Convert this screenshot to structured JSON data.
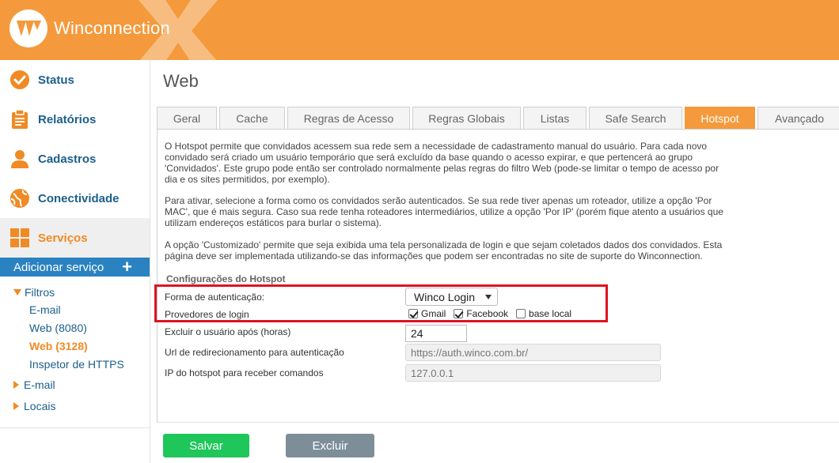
{
  "header": {
    "brand": "Winconnection"
  },
  "sidebar": {
    "items": [
      {
        "label": "Status",
        "icon": "check-circle-icon"
      },
      {
        "label": "Relatórios",
        "icon": "clipboard-icon"
      },
      {
        "label": "Cadastros",
        "icon": "user-icon"
      },
      {
        "label": "Conectividade",
        "icon": "globe-icon"
      },
      {
        "label": "Serviços",
        "icon": "grid-icon"
      }
    ],
    "add_service": "Adicionar serviço",
    "tree": {
      "filtros": "Filtros",
      "filtros_children": [
        "E-mail",
        "Web (8080)",
        "Web (3128)",
        "Inspetor de HTTPS"
      ],
      "email": "E-mail",
      "locais": "Locais"
    }
  },
  "page": {
    "title": "Web"
  },
  "tabs": [
    "Geral",
    "Cache",
    "Regras de Acesso",
    "Regras Globais",
    "Listas",
    "Safe Search",
    "Hotspot",
    "Avançado"
  ],
  "content": {
    "p1": "O Hotspot permite que convidados acessem sua rede sem a necessidade de cadastramento manual do usuário. Para cada novo convidado será criado um usuário temporário que será excluído da base quando o acesso expirar, e que pertencerá ao grupo 'Convidados'. Este grupo pode então ser controlado normalmente pelas regras do filtro Web (pode-se limitar o tempo de acesso por dia e os sites permitidos, por exemplo).",
    "p2": "Para ativar, selecione a forma como os convidados serão autenticados. Se sua rede tiver apenas um roteador, utilize a opção 'Por MAC', que é mais segura. Caso sua rede tenha roteadores intermediários, utilize a opção 'Por IP' (porém fique atento a usuários que utilizam endereços estáticos para burlar o sistema).",
    "p3": "A opção 'Customizado' permite que seja exibida uma tela personalizada de login e que sejam coletados dados dos convidados. Esta página deve ser implementada utilizando-se das informações que podem ser encontradas no site de suporte do Winconnection.",
    "section_title": "Configurações do Hotspot",
    "auth_label": "Forma de autenticação:",
    "auth_value": "Winco Login",
    "providers_label": "Provedores de login",
    "providers": [
      {
        "label": "Gmail",
        "checked": true
      },
      {
        "label": "Facebook",
        "checked": true
      },
      {
        "label": "base local",
        "checked": false
      }
    ],
    "expire_label": "Excluir o usuário após (horas)",
    "expire_value": "24",
    "redirect_label": "Url de redirecionamento para autenticação",
    "redirect_placeholder": "https://auth.winco.com.br/",
    "ip_label": "IP do hotspot para receber comandos",
    "ip_placeholder": "127.0.0.1"
  },
  "buttons": {
    "save": "Salvar",
    "delete": "Excluir"
  },
  "colors": {
    "orange": "#f49a3c",
    "blue": "#2a82c1",
    "navy": "#1c5f8c",
    "green": "#1fc65a",
    "gray": "#7d8e99",
    "red": "#e0121f"
  }
}
